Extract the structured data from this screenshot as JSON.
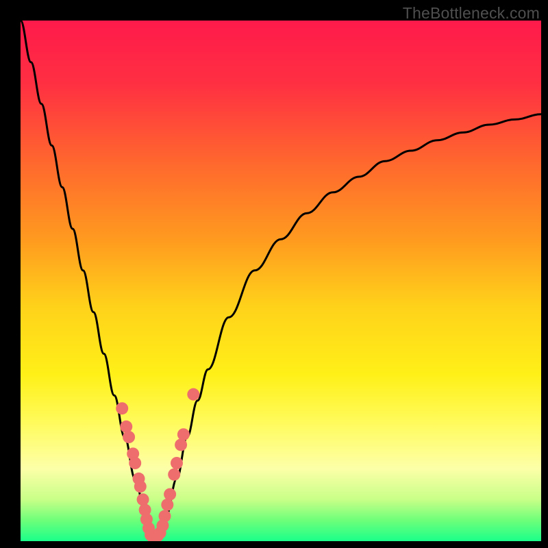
{
  "watermark": "TheBottleneck.com",
  "chart_data": {
    "type": "line",
    "title": "",
    "xlabel": "",
    "ylabel": "",
    "xlim": [
      0,
      100
    ],
    "ylim": [
      0,
      100
    ],
    "grid": false,
    "axes_visible": false,
    "background_gradient": {
      "stops": [
        {
          "pct": 0,
          "color": "#ff1a4b"
        },
        {
          "pct": 12,
          "color": "#ff2f42"
        },
        {
          "pct": 28,
          "color": "#ff6a2d"
        },
        {
          "pct": 42,
          "color": "#ff9a1f"
        },
        {
          "pct": 55,
          "color": "#ffd21a"
        },
        {
          "pct": 68,
          "color": "#fff018"
        },
        {
          "pct": 77,
          "color": "#fffb5a"
        },
        {
          "pct": 86,
          "color": "#fdffa8"
        },
        {
          "pct": 92,
          "color": "#c8ff88"
        },
        {
          "pct": 96,
          "color": "#6eff7a"
        },
        {
          "pct": 100,
          "color": "#1aff8a"
        }
      ]
    },
    "series": [
      {
        "name": "bottleneck-curve",
        "note": "black V-shaped bottleneck curve; y values in percent of plot height (0 = bottom, 100 = top)",
        "x": [
          0,
          2,
          4,
          6,
          8,
          10,
          12,
          14,
          16,
          18,
          20,
          22,
          24,
          25,
          26,
          27,
          28,
          30,
          32,
          34,
          36,
          40,
          45,
          50,
          55,
          60,
          65,
          70,
          75,
          80,
          85,
          90,
          95,
          100
        ],
        "y": [
          100,
          92,
          84,
          76,
          68,
          60,
          52,
          44,
          36,
          28,
          20,
          12,
          5,
          1,
          0,
          1,
          5,
          12,
          20,
          27,
          33,
          43,
          52,
          58,
          63,
          67,
          70,
          73,
          75,
          77,
          78.5,
          80,
          81,
          82
        ]
      }
    ],
    "scatter_overlay": {
      "name": "highlight-dots",
      "color": "#ee6d6d",
      "radius_px": 9,
      "note": "pink dots clustered around the trough; (x,y) in percent",
      "points": [
        [
          19.5,
          25.5
        ],
        [
          20.3,
          22.0
        ],
        [
          20.8,
          20.0
        ],
        [
          21.6,
          16.8
        ],
        [
          22.0,
          15.0
        ],
        [
          22.7,
          12.0
        ],
        [
          23.0,
          10.5
        ],
        [
          23.5,
          8.0
        ],
        [
          23.9,
          6.0
        ],
        [
          24.2,
          4.2
        ],
        [
          24.6,
          2.5
        ],
        [
          25.0,
          1.2
        ],
        [
          25.4,
          0.8
        ],
        [
          25.9,
          0.8
        ],
        [
          26.3,
          1.0
        ],
        [
          26.8,
          1.6
        ],
        [
          27.3,
          3.0
        ],
        [
          27.7,
          4.8
        ],
        [
          28.2,
          7.0
        ],
        [
          28.7,
          9.0
        ],
        [
          29.5,
          12.8
        ],
        [
          30.0,
          15.0
        ],
        [
          30.8,
          18.5
        ],
        [
          31.3,
          20.5
        ],
        [
          33.2,
          28.2
        ]
      ]
    }
  }
}
